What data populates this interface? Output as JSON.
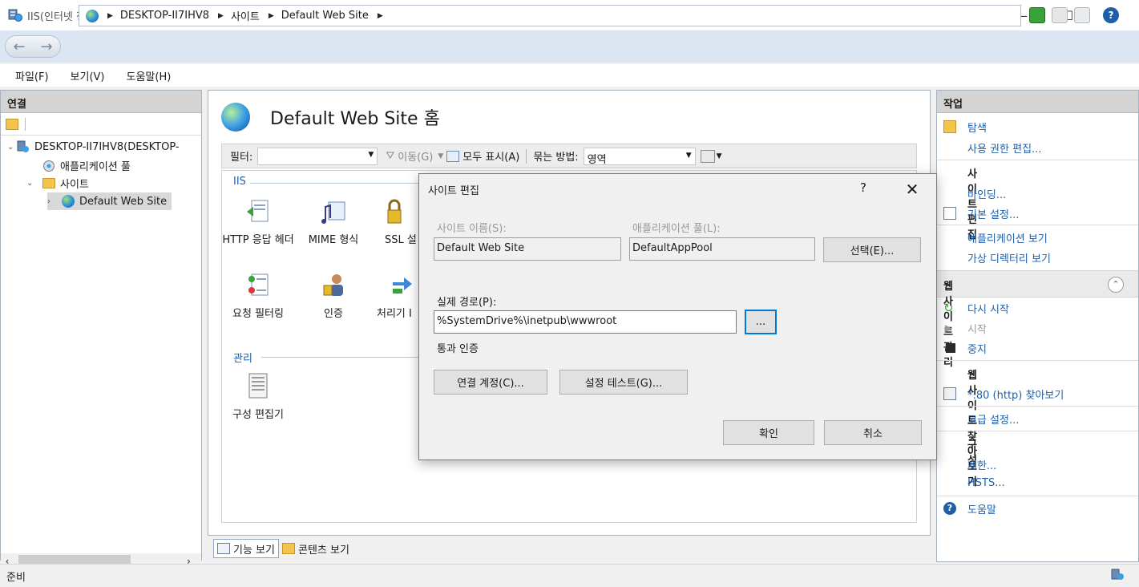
{
  "window": {
    "title": "IIS(인터넷 정보 서비스) 관리자",
    "minimize": "—",
    "maximize": "☐",
    "close": "✕"
  },
  "address": {
    "crumbs": [
      "DESKTOP-II7IHV8",
      "사이트",
      "Default Web Site"
    ]
  },
  "menu": {
    "items": [
      "파일(F)",
      "보기(V)",
      "도움말(H)"
    ]
  },
  "connections": {
    "header": "연결",
    "tree": {
      "server": "DESKTOP-II7IHV8(DESKTOP-",
      "app_pools": "애플리케이션 풀",
      "sites": "사이트",
      "default_site": "Default Web Site"
    }
  },
  "center": {
    "title": "Default Web Site 홈",
    "filter_label": "필터:",
    "go_label": "이동(G)",
    "show_all_label": "모두 표시(A)",
    "group_by_label": "묶는 방법:",
    "group_by_value": "영역",
    "group_iis": "IIS",
    "group_manage": "관리",
    "features": {
      "http_headers": "HTTP 응답 헤더",
      "mime": "MIME 형식",
      "ssl": "SSL 설",
      "request_filter": "요청 필터링",
      "auth": "인증",
      "handler": "처리기 I",
      "config_editor": "구성 편집기"
    },
    "tab_features": "기능 보기",
    "tab_content": "콘텐츠 보기"
  },
  "actions": {
    "header": "작업",
    "explore": "탐색",
    "edit_permissions": "사용 권한 편집...",
    "edit_site_head": "사이트 편집",
    "bindings": "바인딩...",
    "basic_settings": "기본 설정...",
    "view_apps": "애플리케이션 보기",
    "view_vdirs": "가상 디렉터리 보기",
    "manage_head": "웹 사이트 관리",
    "restart": "다시 시작",
    "start": "시작",
    "stop": "중지",
    "browse_head": "웹 사이트 찾아보기",
    "browse_80": "*:80 (http) 찾아보기",
    "advanced": "고급 설정...",
    "config_head": "구성",
    "limits": "제한...",
    "hsts": "HSTS...",
    "help": "도움말"
  },
  "status": {
    "text": "준비"
  },
  "dialog": {
    "title": "사이트 편집",
    "help": "?",
    "close": "✕",
    "site_name_label": "사이트 이름(S):",
    "site_name_value": "Default Web Site",
    "app_pool_label": "애플리케이션 풀(L):",
    "app_pool_value": "DefaultAppPool",
    "select_button": "선택(E)...",
    "physical_path_label": "실제 경로(P):",
    "physical_path_value": "%SystemDrive%\\inetpub\\wwwroot",
    "browse_button": "...",
    "pass_through_label": "통과 인증",
    "connect_as_button": "연결 계정(C)...",
    "test_settings_button": "설정 테스트(G)...",
    "ok_button": "확인",
    "cancel_button": "취소"
  }
}
